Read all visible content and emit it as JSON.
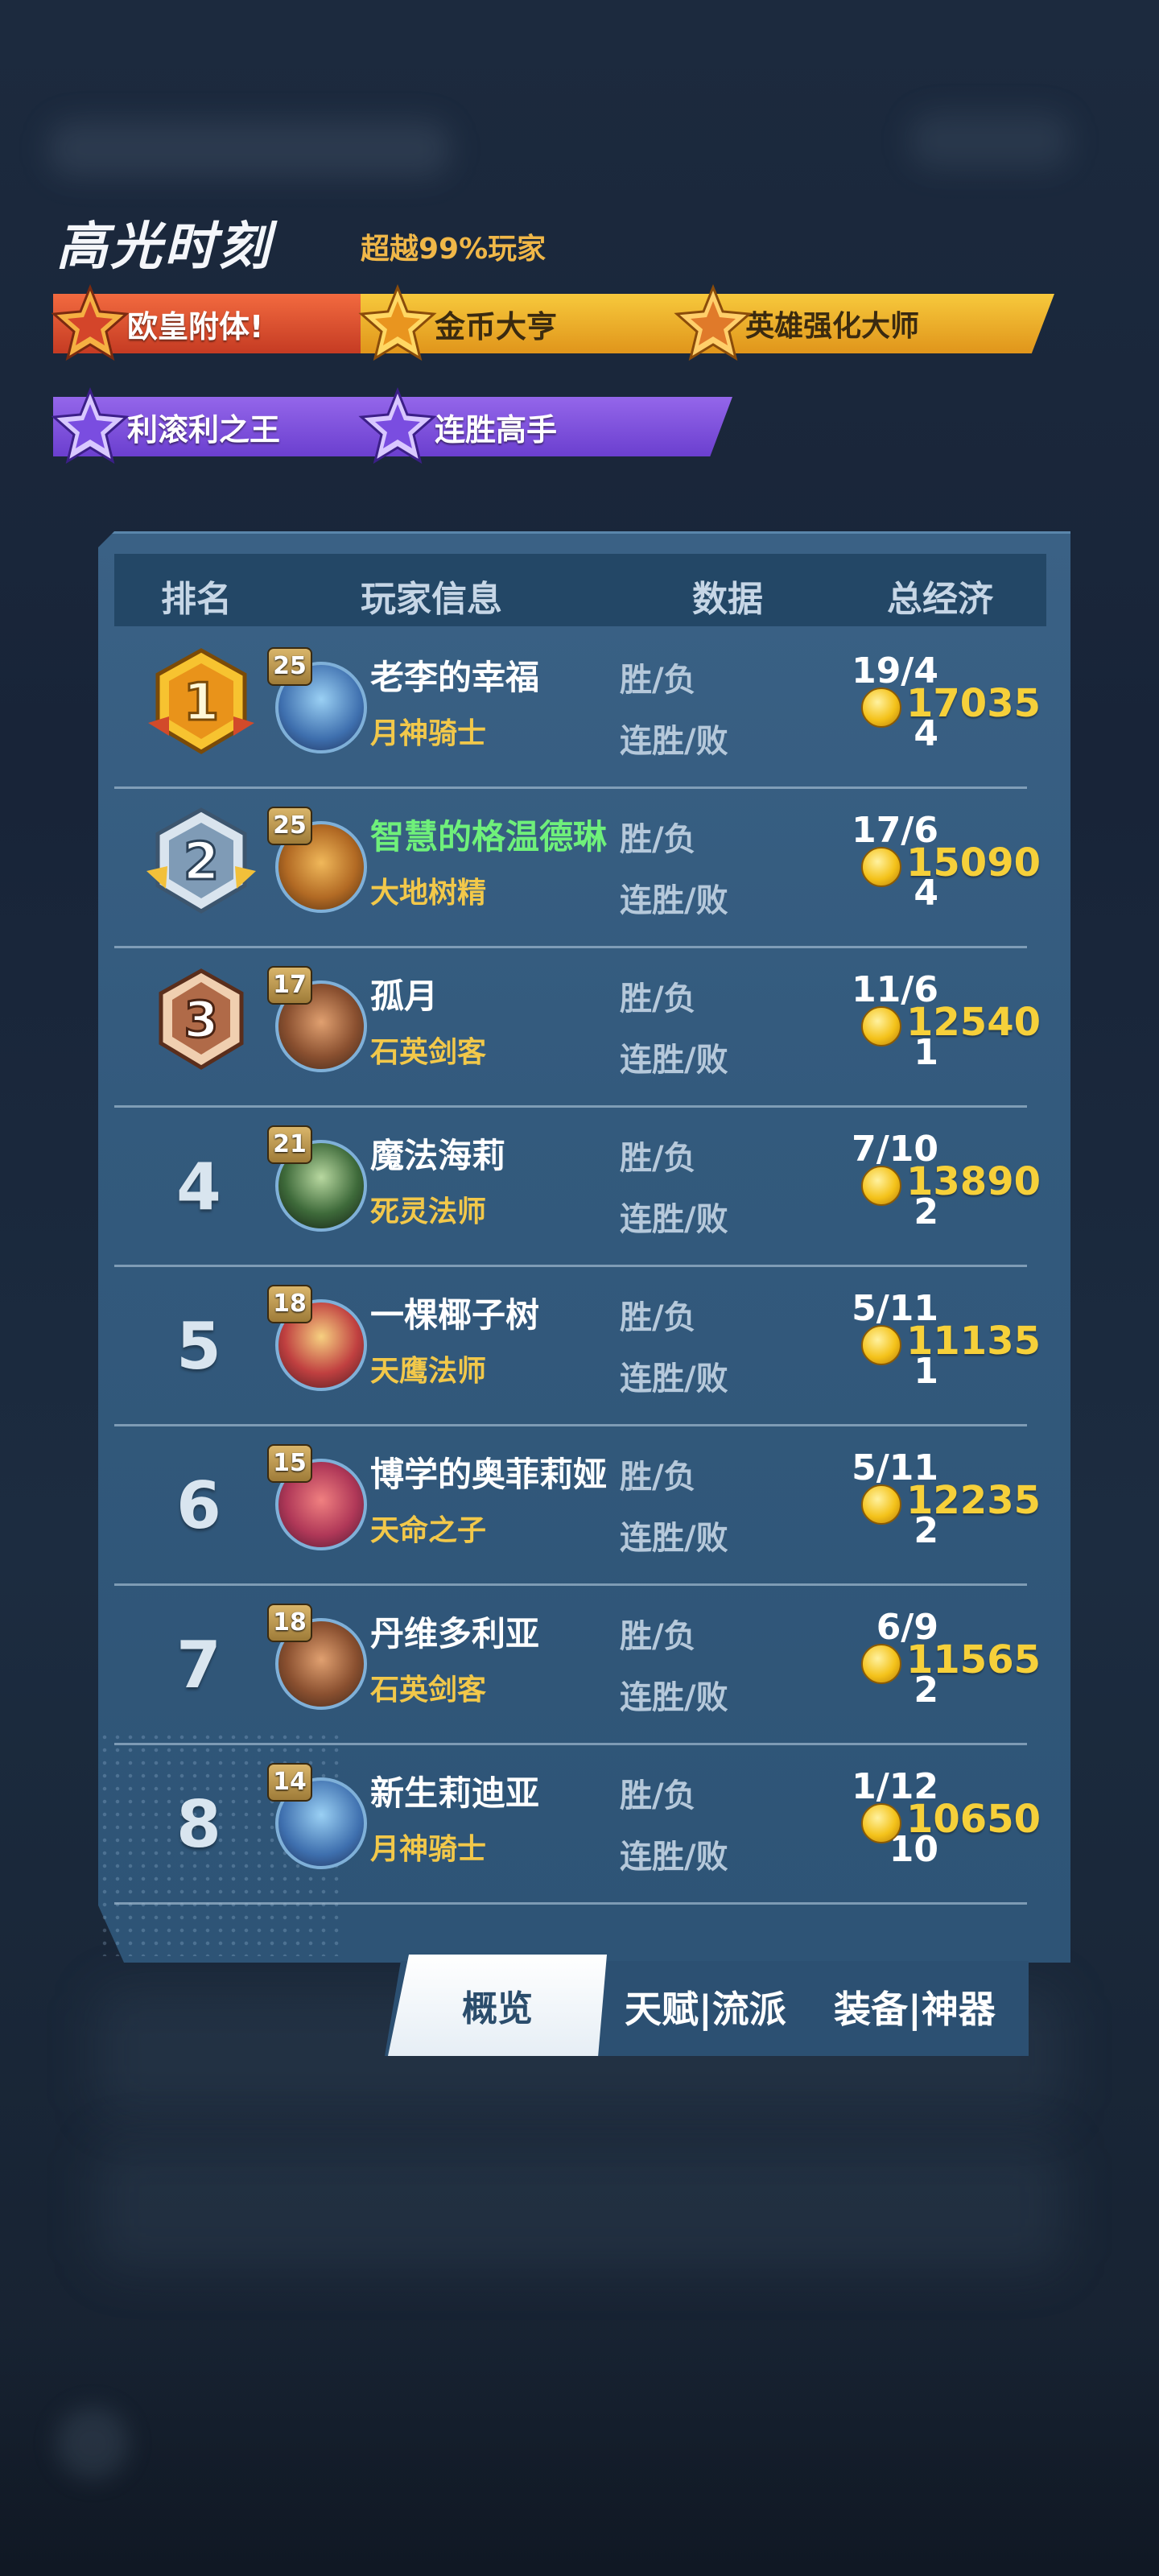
{
  "highlights": {
    "title": "高光时刻",
    "subtitle": "超越99%玩家",
    "badges": [
      {
        "label": "欧皇附体!",
        "color": "red"
      },
      {
        "label": "金币大亨",
        "color": "gold"
      },
      {
        "label": "英雄强化大师",
        "color": "gold"
      },
      {
        "label": "利滚利之王",
        "color": "purple"
      },
      {
        "label": "连胜高手",
        "color": "purple"
      }
    ]
  },
  "table": {
    "headers": {
      "rank": "排名",
      "player": "玩家信息",
      "data": "数据",
      "economy": "总经济"
    },
    "win_loss_label": "胜/负",
    "streak_label": "连胜/败",
    "rows": [
      {
        "rank": "1",
        "level": "25",
        "name": "老李的幸福",
        "hero": "月神骑士",
        "win_loss": "19/4",
        "streak": "4",
        "economy": "17035"
      },
      {
        "rank": "2",
        "level": "25",
        "name": "智慧的格温德琳",
        "hero": "大地树精",
        "win_loss": "17/6",
        "streak": "4",
        "economy": "15090",
        "highlight": true
      },
      {
        "rank": "3",
        "level": "17",
        "name": "孤月",
        "hero": "石英剑客",
        "win_loss": "11/6",
        "streak": "1",
        "economy": "12540"
      },
      {
        "rank": "4",
        "level": "21",
        "name": "魔法海莉",
        "hero": "死灵法师",
        "win_loss": "7/10",
        "streak": "2",
        "economy": "13890"
      },
      {
        "rank": "5",
        "level": "18",
        "name": "一棵椰子树",
        "hero": "天鹰法师",
        "win_loss": "5/11",
        "streak": "1",
        "economy": "11135"
      },
      {
        "rank": "6",
        "level": "15",
        "name": "博学的奥菲莉娅",
        "hero": "天命之子",
        "win_loss": "5/11",
        "streak": "2",
        "economy": "12235"
      },
      {
        "rank": "7",
        "level": "18",
        "name": "丹维多利亚",
        "hero": "石英剑客",
        "win_loss": "6/9",
        "streak": "2",
        "economy": "11565"
      },
      {
        "rank": "8",
        "level": "14",
        "name": "新生莉迪亚",
        "hero": "月神骑士",
        "win_loss": "1/12",
        "streak": "10",
        "economy": "10650"
      }
    ]
  },
  "tabs": [
    {
      "label": "概览",
      "active": true
    },
    {
      "label": "天赋|流派",
      "active": false
    },
    {
      "label": "装备|神器",
      "active": false
    }
  ],
  "colors": {
    "gold_text": "#f6d03a",
    "highlight_name": "#6ff07a",
    "panel": "#335a7d"
  }
}
